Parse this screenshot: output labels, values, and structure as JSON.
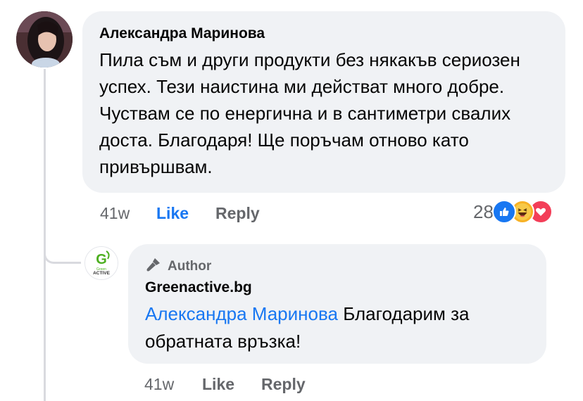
{
  "comment": {
    "author": "Александра Маринова",
    "text": "Пила съм и други продукти без някакъв сериозен успех. Тези наистина ми действат много добре. Чуствам се по енергична и в сантиметри свалих доста. Благодаря! Ще поръчам отново като привършвам.",
    "time": "41w",
    "like_label": "Like",
    "reply_label": "Reply",
    "reaction_count": "28",
    "reaction_icons": [
      "like-icon",
      "haha-icon",
      "love-icon"
    ],
    "colors": {
      "like": "#1877f2",
      "haha": "#f7b125",
      "love": "#f33e58"
    }
  },
  "reply": {
    "badge_label": "Author",
    "author": "Greenactive.bg",
    "mention": "Александра Маринова",
    "text": "Благодарим за обратната връзка!",
    "time": "41w",
    "like_label": "Like",
    "reply_label": "Reply",
    "logo_text_top": "Green",
    "logo_text_bottom": "ACTIVE",
    "logo_letter": "G",
    "colors": {
      "logo_green": "#4caf1f"
    }
  }
}
